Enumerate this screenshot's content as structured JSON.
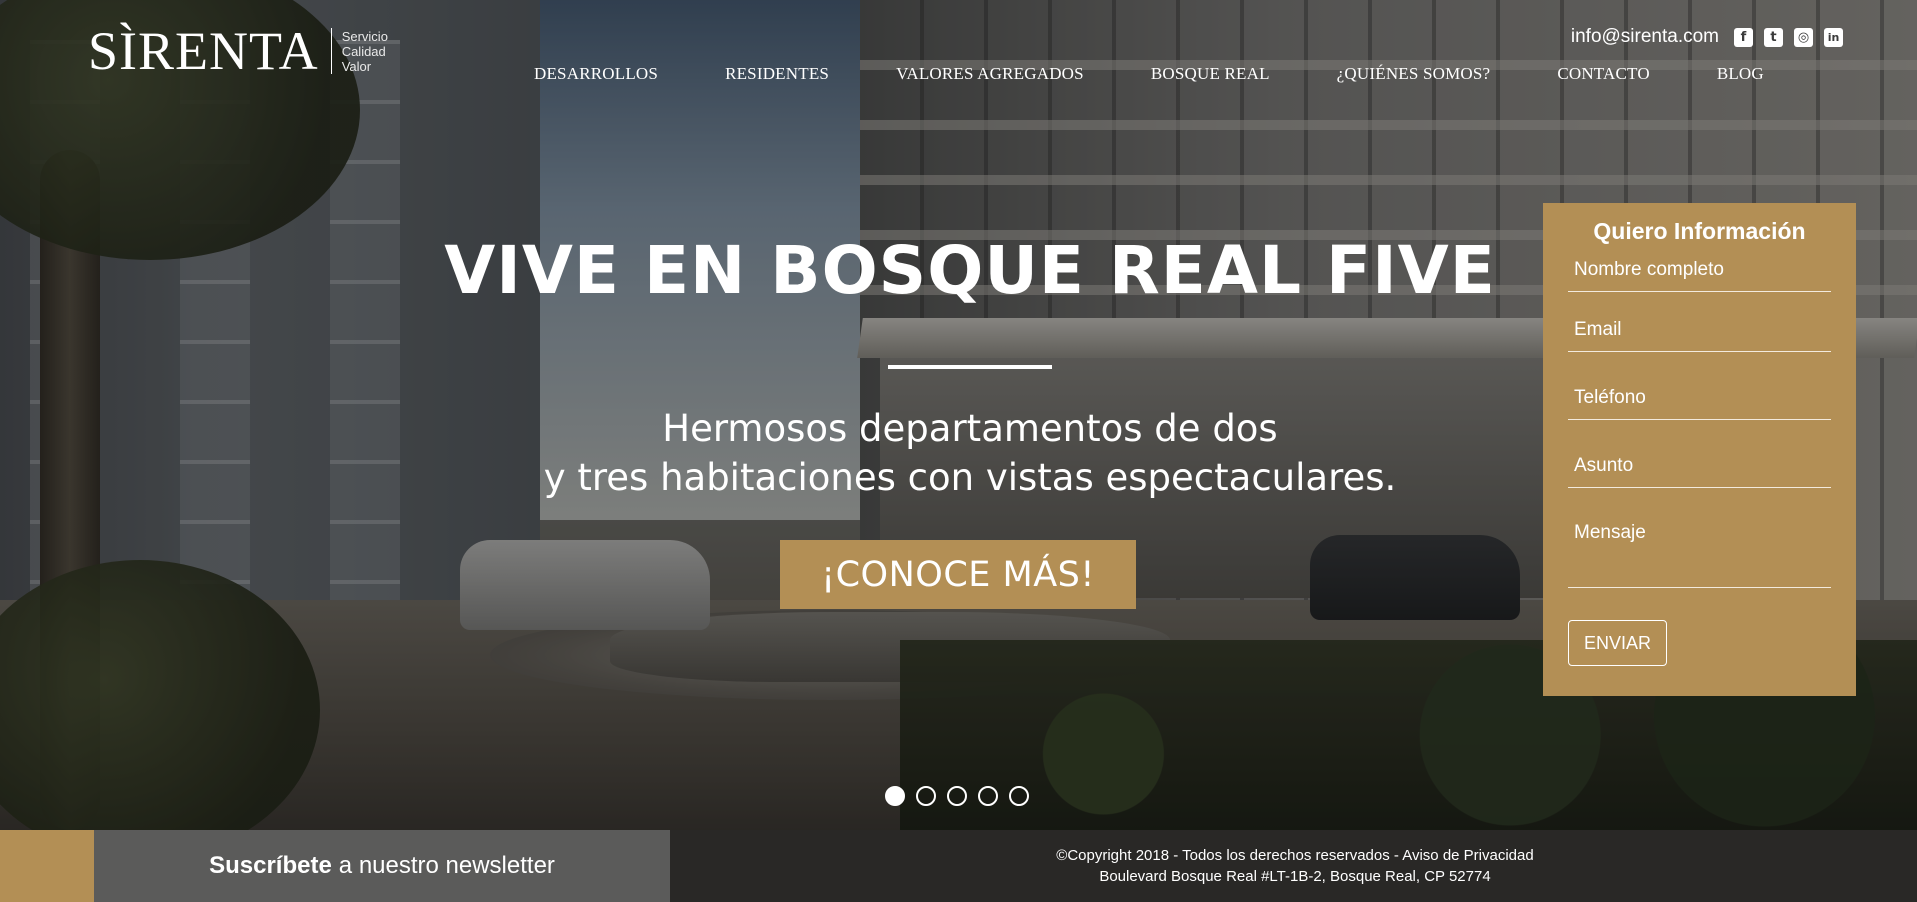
{
  "brand": {
    "logo_word": "SÌRENTA",
    "tagline": [
      "Servicio",
      "Calidad",
      "Valor"
    ]
  },
  "header": {
    "email": "info@sirenta.com",
    "social": [
      {
        "icon": "facebook-icon",
        "glyph": "f"
      },
      {
        "icon": "twitter-icon",
        "glyph": "t"
      },
      {
        "icon": "instagram-icon",
        "glyph": "◎"
      },
      {
        "icon": "linkedin-icon",
        "glyph": "in"
      }
    ]
  },
  "nav": {
    "items": [
      {
        "label": "DESARROLLOS"
      },
      {
        "label": "RESIDENTES"
      },
      {
        "label": "VALORES AGREGADOS"
      },
      {
        "label": "BOSQUE REAL"
      },
      {
        "label": "¿QUIÉNES SOMOS?"
      },
      {
        "label": "CONTACTO"
      },
      {
        "label": "BLOG"
      }
    ]
  },
  "hero": {
    "headline": "VIVE EN BOSQUE REAL FIVE",
    "subhead_line1": "Hermosos departamentos de dos",
    "subhead_line2": "y tres habitaciones con vistas espectaculares.",
    "cta_label": "¡CONOCE MÁS!",
    "slides_total": 5,
    "active_slide": 1
  },
  "form": {
    "title": "Quiero Información",
    "fields": {
      "name_placeholder": "Nombre completo",
      "email_placeholder": "Email",
      "phone_placeholder": "Teléfono",
      "subject_placeholder": "Asunto",
      "message_placeholder": "Mensaje"
    },
    "submit_label": "ENVIAR"
  },
  "footer": {
    "newsletter_bold": "Suscríbete",
    "newsletter_rest": "a nuestro newsletter",
    "copyright": "©Copyright 2018 - Todos los derechos reservados - Aviso de Privacidad",
    "address": "Boulevard Bosque Real #LT-1B-2, Bosque Real, CP 52774"
  },
  "colors": {
    "accent": "#b38f55",
    "footer_dark": "#292826",
    "newsletter_gray": "#5b5b5a"
  }
}
